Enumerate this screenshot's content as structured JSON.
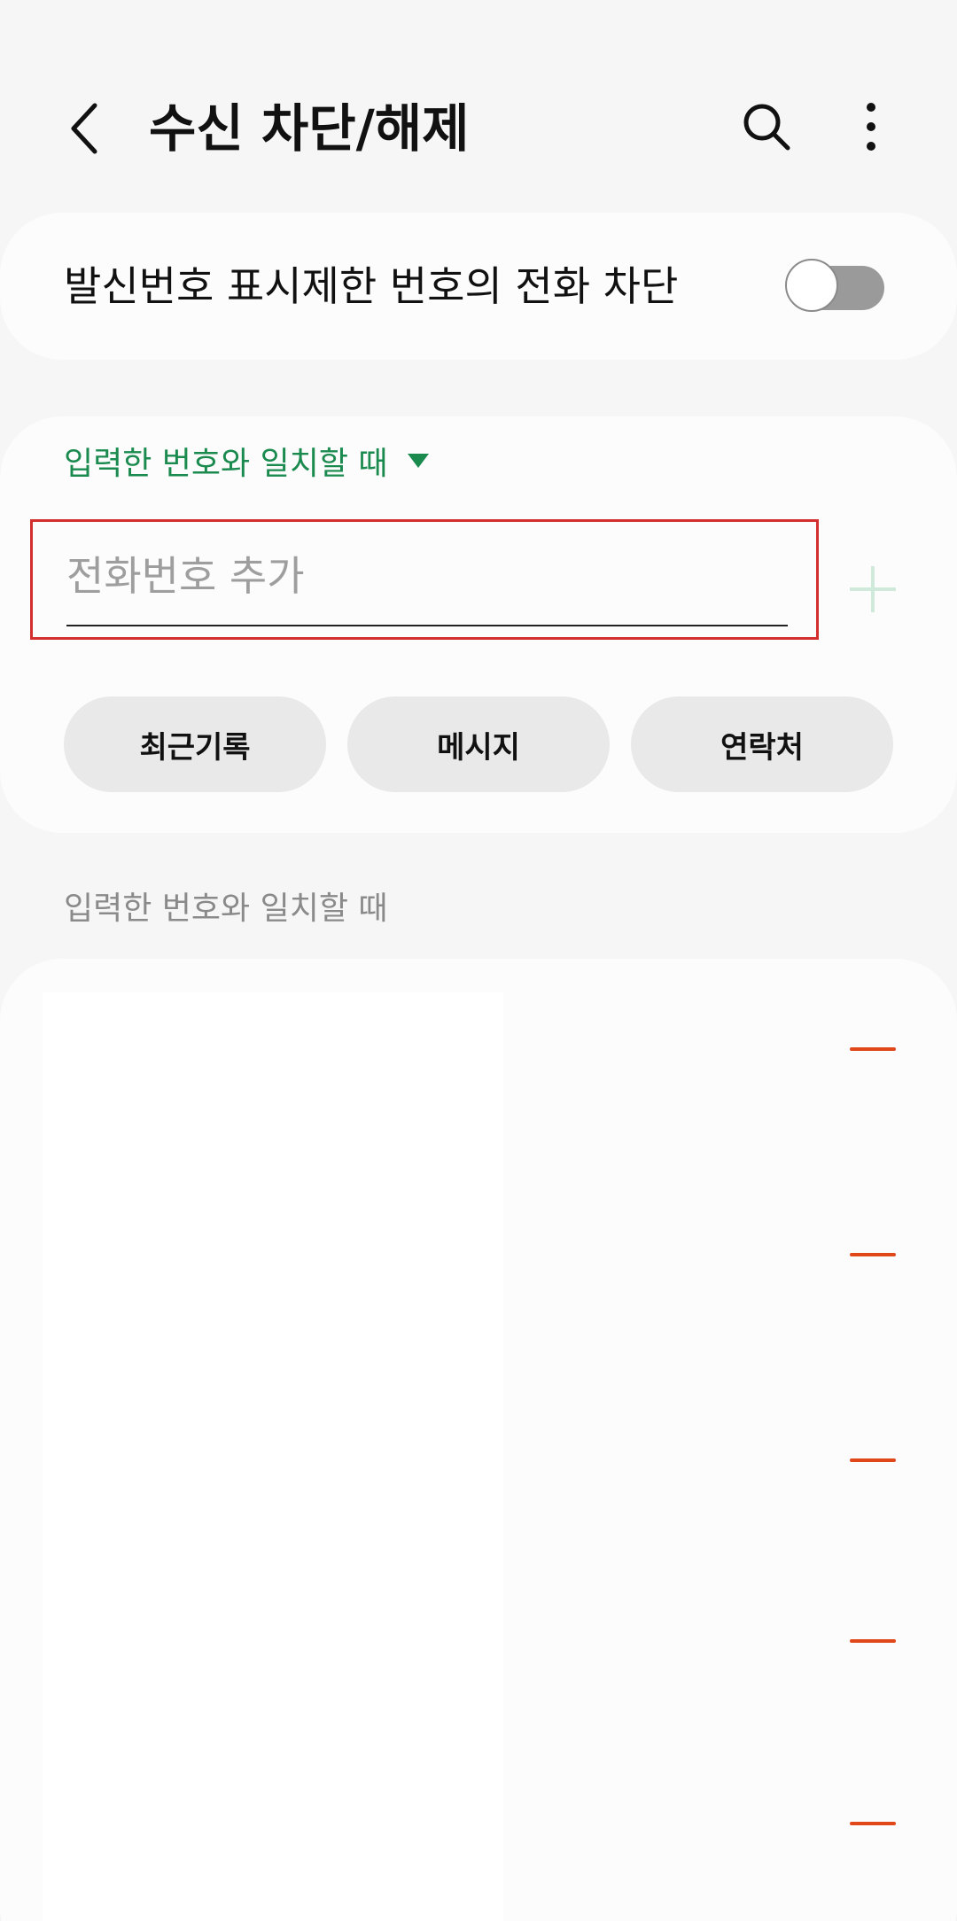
{
  "header": {
    "title": "수신 차단/해제",
    "back_icon": "chevron-left-icon",
    "search_icon": "search-icon",
    "more_icon": "more-vertical-icon"
  },
  "block_unknown": {
    "label": "발신번호 표시제한 번호의 전화 차단",
    "enabled": false
  },
  "add_number": {
    "match_mode_label": "입력한 번호와 일치할 때",
    "placeholder": "전화번호 추가",
    "value": "",
    "add_icon": "plus-icon"
  },
  "sources": [
    {
      "label": "최근기록"
    },
    {
      "label": "메시지"
    },
    {
      "label": "연락처"
    }
  ],
  "blocked_list": {
    "section_label": "입력한 번호와 일치할 때",
    "items": [
      {
        "number": ""
      },
      {
        "number": ""
      },
      {
        "number": ""
      },
      {
        "number": ""
      },
      {
        "number": ""
      }
    ]
  },
  "colors": {
    "accent_green": "#1a8a4f",
    "remove_red": "#e0481a",
    "highlight_border": "#d32f2f"
  }
}
